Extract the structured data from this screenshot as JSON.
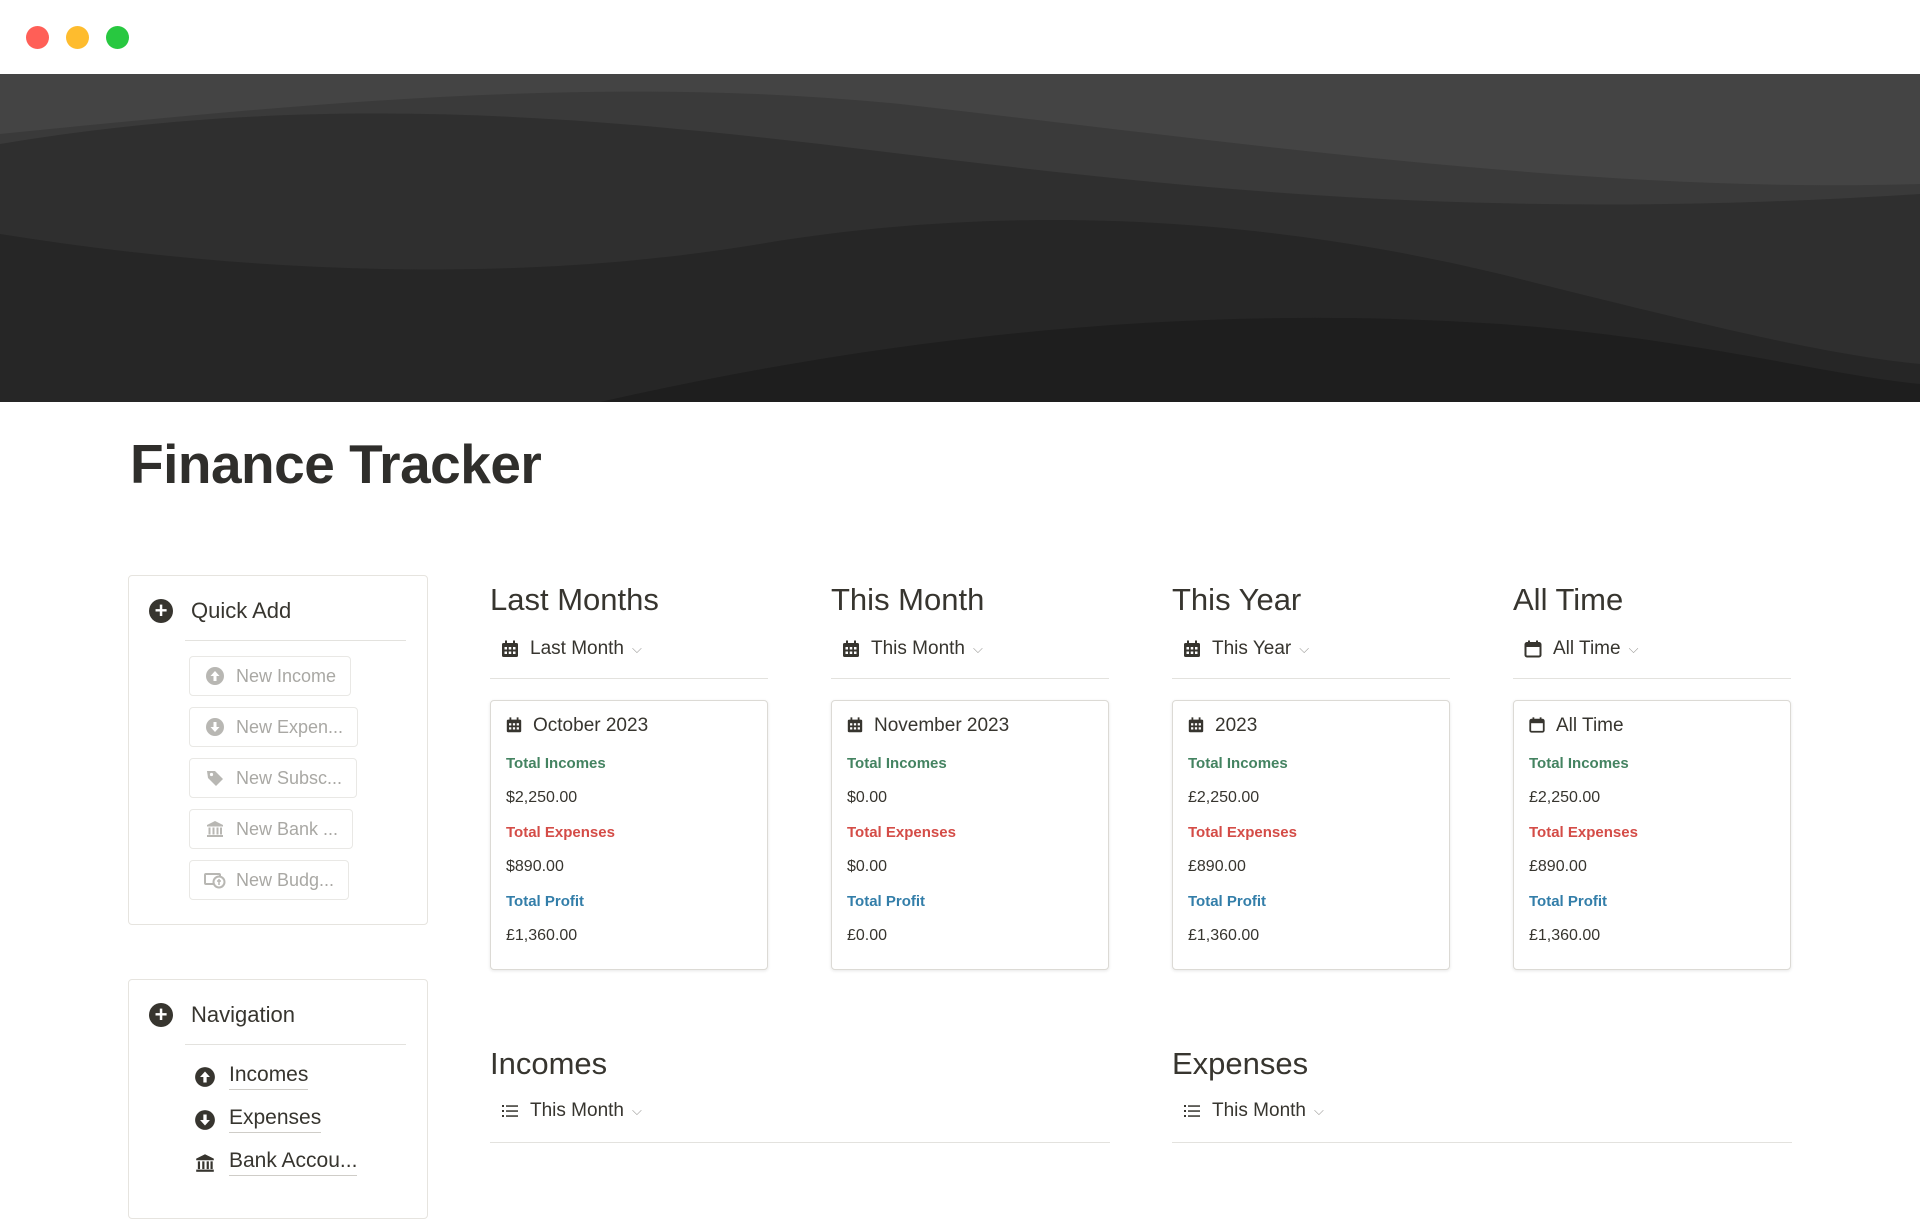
{
  "page": {
    "title": "Finance Tracker"
  },
  "quick_add": {
    "heading": "Quick Add",
    "buttons": [
      {
        "label": "New Income",
        "icon": "arrow-up-circle-icon"
      },
      {
        "label": "New Expen...",
        "icon": "arrow-down-circle-icon"
      },
      {
        "label": "New Subsc...",
        "icon": "tag-icon"
      },
      {
        "label": "New Bank ...",
        "icon": "bank-icon"
      },
      {
        "label": "New Budg...",
        "icon": "money-icon"
      }
    ]
  },
  "navigation": {
    "heading": "Navigation",
    "items": [
      {
        "label": "Incomes",
        "icon": "arrow-up-circle-icon"
      },
      {
        "label": "Expenses",
        "icon": "arrow-down-circle-icon"
      },
      {
        "label": "Bank Accou...",
        "icon": "bank-icon"
      }
    ]
  },
  "summaries": [
    {
      "heading": "Last Months",
      "view": "Last Month",
      "card_title": "October 2023",
      "incomes_label": "Total Incomes",
      "incomes": "$2,250.00",
      "expenses_label": "Total Expenses",
      "expenses": "$890.00",
      "profit_label": "Total Profit",
      "profit": "£1,360.00"
    },
    {
      "heading": "This Month",
      "view": "This Month",
      "card_title": "November 2023",
      "incomes_label": "Total Incomes",
      "incomes": "$0.00",
      "expenses_label": "Total Expenses",
      "expenses": "$0.00",
      "profit_label": "Total Profit",
      "profit": "£0.00"
    },
    {
      "heading": "This Year",
      "view": "This Year",
      "card_title": "2023",
      "incomes_label": "Total Incomes",
      "incomes": "£2,250.00",
      "expenses_label": "Total Expenses",
      "expenses": "£890.00",
      "profit_label": "Total Profit",
      "profit": "£1,360.00"
    },
    {
      "heading": "All Time",
      "view": "All Time",
      "card_title": "All Time",
      "incomes_label": "Total Incomes",
      "incomes": "£2,250.00",
      "expenses_label": "Total Expenses",
      "expenses": "£890.00",
      "profit_label": "Total Profit",
      "profit": "£1,360.00"
    }
  ],
  "sections": [
    {
      "heading": "Incomes",
      "view": "This Month"
    },
    {
      "heading": "Expenses",
      "view": "This Month"
    }
  ],
  "colors": {
    "income": "#448361",
    "expense": "#d44c47",
    "profit": "#337ea9",
    "cover": "#262626"
  }
}
